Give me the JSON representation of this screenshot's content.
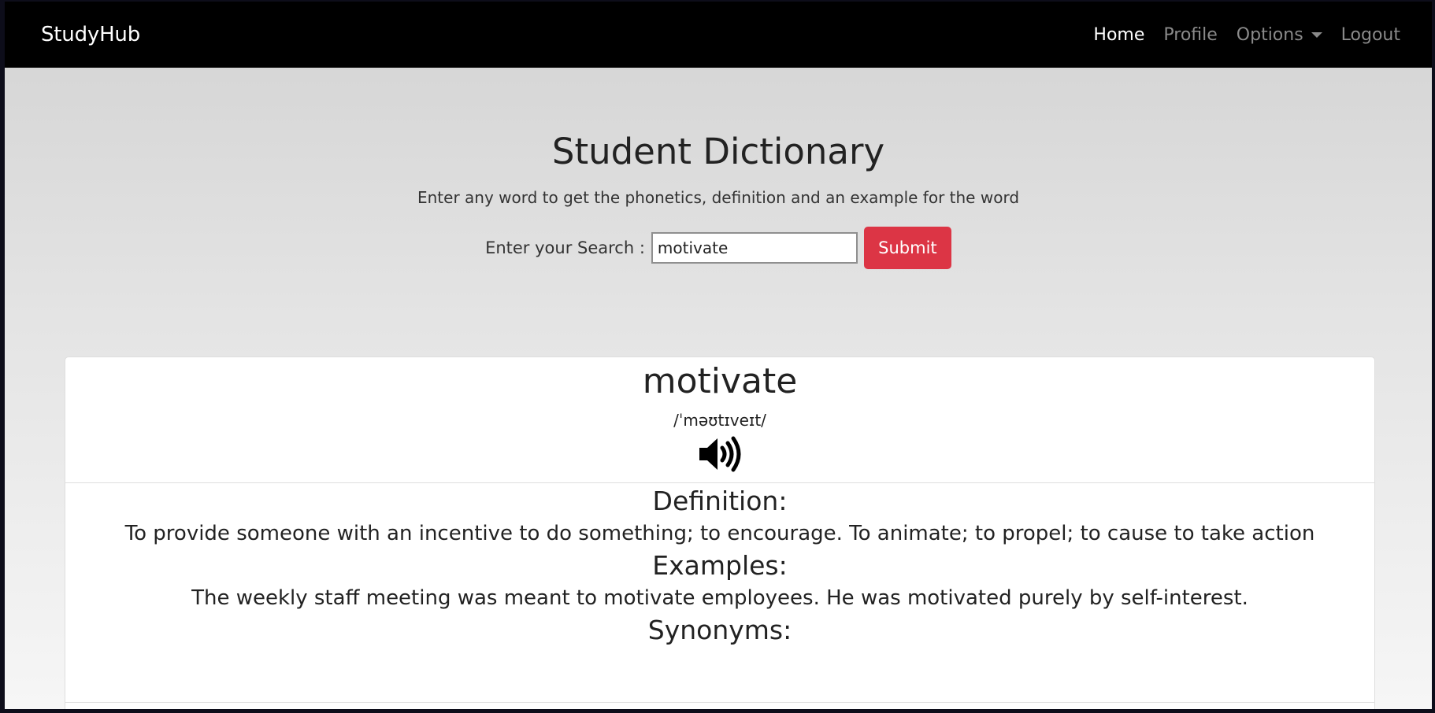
{
  "navbar": {
    "brand": "StudyHub",
    "links": [
      {
        "label": "Home",
        "active": true
      },
      {
        "label": "Profile",
        "active": false
      },
      {
        "label": "Options",
        "active": false,
        "dropdown": true
      },
      {
        "label": "Logout",
        "active": false
      }
    ]
  },
  "hero": {
    "title": "Student Dictionary",
    "subtitle": "Enter any word to get the phonetics, definition and an example for the word",
    "search_label": "Enter your Search :",
    "search_value": "motivate",
    "submit_label": "Submit"
  },
  "result": {
    "word": "motivate",
    "phonetic": "/ˈməʊtɪveɪt/",
    "audio_icon": "speaker-volume-icon",
    "definition_heading": "Definition:",
    "definition_text": "To provide someone with an incentive to do something; to encourage. To animate; to propel; to cause to take action",
    "examples_heading": "Examples:",
    "examples_text": "The weekly staff meeting was meant to motivate employees. He was motivated purely by self-interest.",
    "synonyms_heading": "Synonyms:"
  },
  "colors": {
    "navbar_bg": "#000000",
    "submit_bg": "#dc3545",
    "nav_active": "#ffffff",
    "nav_inactive": "#8a8a8a"
  }
}
